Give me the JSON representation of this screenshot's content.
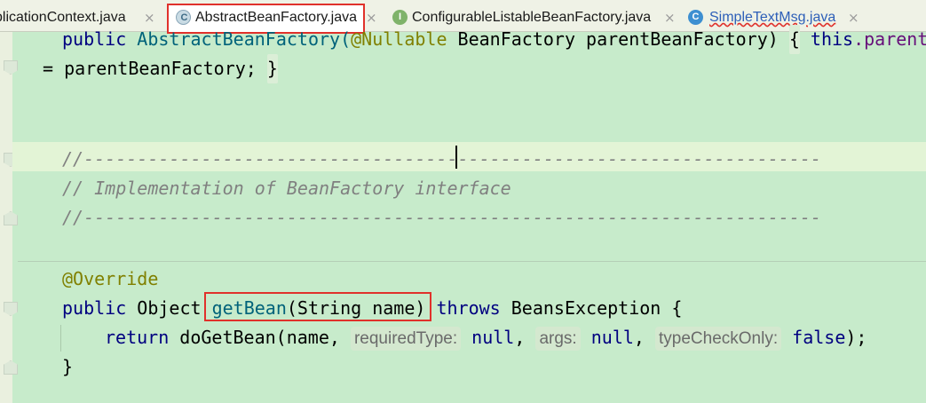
{
  "tabs": [
    {
      "label": "plicationContext.java",
      "icon": "class-icon",
      "icon_letter": "",
      "active": false
    },
    {
      "label": "AbstractBeanFactory.java",
      "icon": "abstract-class-icon",
      "icon_letter": "C",
      "active": true
    },
    {
      "label": "ConfigurableListableBeanFactory.java",
      "icon": "interface-icon",
      "icon_letter": "I",
      "active": false
    },
    {
      "label": "SimpleTextMsg.java",
      "icon": "class-icon",
      "icon_letter": "C",
      "active": false
    }
  ],
  "close_glyph": "×",
  "code": {
    "line1": {
      "kw": "public ",
      "cls": "AbstractBeanFactory(",
      "ann": "@Nullable",
      "rest": " BeanFactory parentBeanFactory) ",
      "brace": "{",
      "tail_kw": " this",
      "tail": ".parent"
    },
    "line2": {
      "text": "= parentBeanFactory; ",
      "brace": "}"
    },
    "line4": "//---------------------------------------------------------------------",
    "line5": "// Implementation of BeanFactory interface",
    "line6": "//---------------------------------------------------------------------",
    "line8": "@Override",
    "line9": {
      "kw": "public ",
      "type": "Object ",
      "method": "getBean",
      "params": "(String name)",
      "throws": " throws ",
      "exc": "BeansException {"
    },
    "line10": {
      "kw": "return ",
      "call": "doGetBean(name, ",
      "hint1": "requiredType:",
      "v1": " null",
      "sep1": ", ",
      "hint2": "args:",
      "v2": " null",
      "sep2": ", ",
      "hint3": "typeCheckOnly:",
      "v3": " false",
      "end": ");"
    },
    "line11": "}"
  },
  "colors": {
    "editor_bg": "#c7ebcb",
    "highlight_box": "#e0312b",
    "keyword": "#000080",
    "comment": "#808080",
    "annotation": "#808000"
  }
}
